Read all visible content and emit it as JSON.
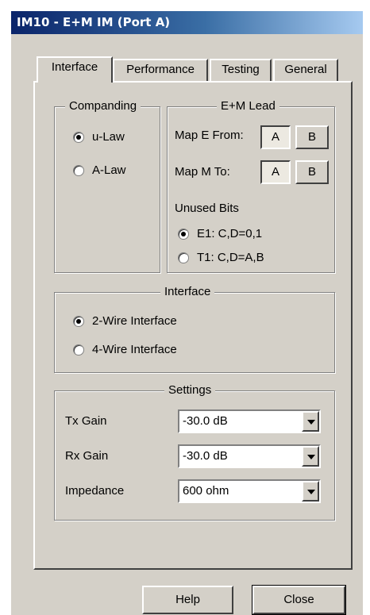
{
  "window": {
    "title": "IM10 - E+M IM (Port A)"
  },
  "tabs": [
    {
      "label": "Interface"
    },
    {
      "label": "Performance"
    },
    {
      "label": "Testing"
    },
    {
      "label": "General"
    }
  ],
  "companding": {
    "legend": "Companding",
    "options": [
      {
        "label": "u-Law",
        "selected": true
      },
      {
        "label": "A-Law",
        "selected": false
      }
    ]
  },
  "em_lead": {
    "legend": "E+M Lead",
    "map_e_label": "Map E From:",
    "map_m_label": "Map M To:",
    "btn_a": "A",
    "btn_b": "B",
    "unused_bits_label": "Unused Bits",
    "options": [
      {
        "label": "E1: C,D=0,1",
        "selected": true
      },
      {
        "label": "T1: C,D=A,B",
        "selected": false
      }
    ]
  },
  "interface": {
    "legend": "Interface",
    "options": [
      {
        "label": "2-Wire Interface",
        "selected": true
      },
      {
        "label": "4-Wire Interface",
        "selected": false
      }
    ]
  },
  "settings": {
    "legend": "Settings",
    "tx_label": "Tx Gain",
    "tx_value": "-30.0 dB",
    "rx_label": "Rx Gain",
    "rx_value": "-30.0 dB",
    "imp_label": "Impedance",
    "imp_value": "600 ohm"
  },
  "footer": {
    "help": "Help",
    "close": "Close"
  }
}
